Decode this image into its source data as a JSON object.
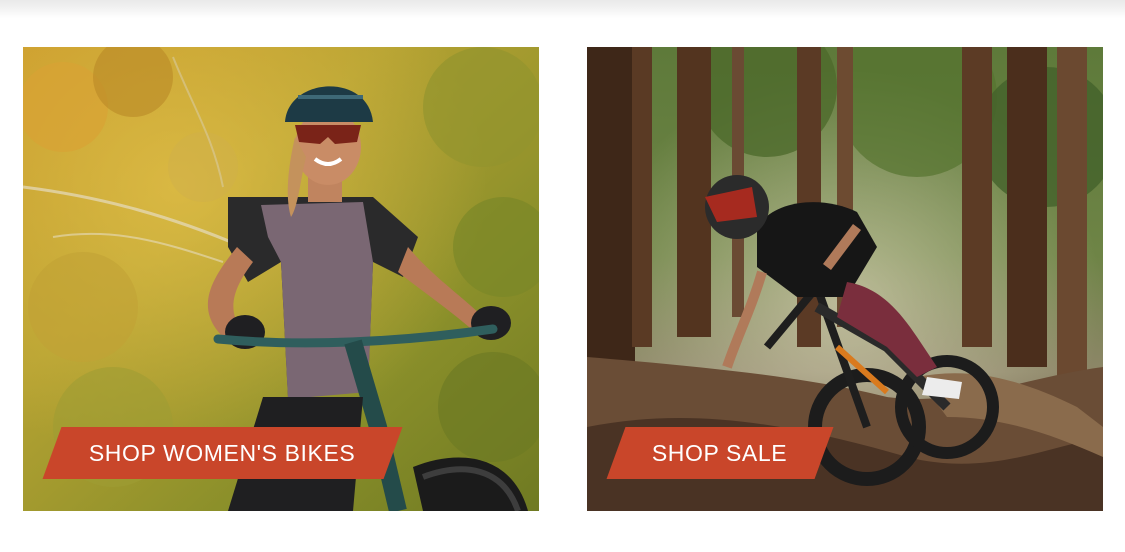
{
  "colors": {
    "cta_background": "#c9462a",
    "cta_text": "#ffffff",
    "page_background": "#ffffff"
  },
  "promos": [
    {
      "label": "SHOP WOMEN'S BIKES",
      "image_alt": "Smiling woman in a helmet and sunglasses riding a mountain bike in autumn foliage",
      "icon": "womens-bikes-photo"
    },
    {
      "label": "SHOP SALE",
      "image_alt": "Rider in full-face helmet cornering a mountain bike on a forest dirt berm",
      "icon": "sale-bike-photo"
    }
  ]
}
